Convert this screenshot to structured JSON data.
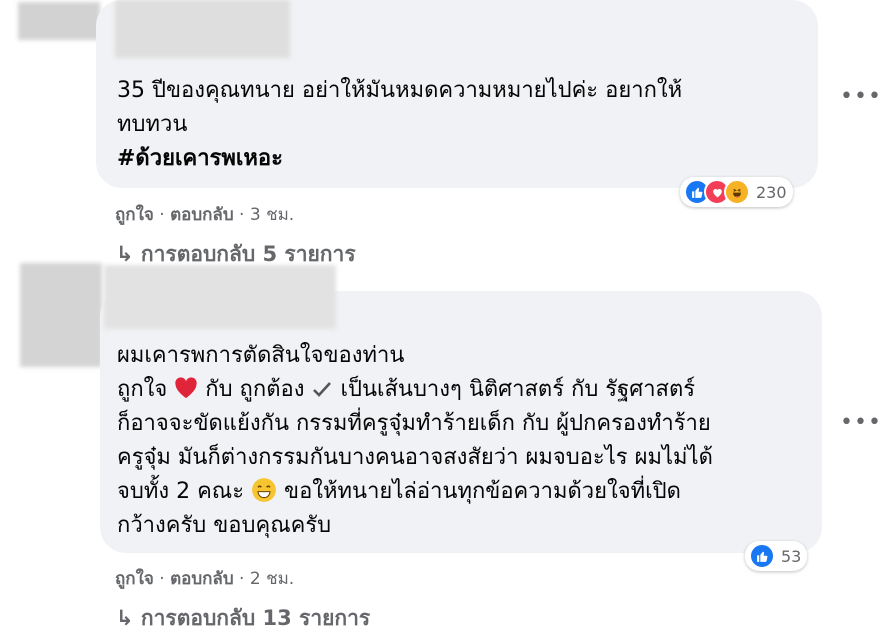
{
  "comments": [
    {
      "text_lines": [
        "35 ปีของคุณทนาย อย่าให้มันหมดความหมายไปค่ะ อยากให้",
        "ทบทวน"
      ],
      "hashtag": "#ด้วยเคารพเหอะ",
      "actions": {
        "like": "ถูกใจ",
        "reply": "ตอบกลับ",
        "time": "3 ชม."
      },
      "reaction_count": "230",
      "reactions": [
        "like-icon",
        "love-icon",
        "haha-icon"
      ],
      "replies_label": "การตอบกลับ 5 รายการ"
    },
    {
      "text_lines": [
        "ผมเคารพการตัดสินใจของท่าน",
        "ถูกใจ",
        "กับ ถูกต้อง",
        "เป็นเส้นบางๆ นิติศาสตร์ กับ รัฐศาสตร์",
        "ก็อาจจะขัดแย้งกัน กรรมที่ครูจุ๋มทำร้ายเด็ก กับ ผู้ปกครองทำร้าย",
        "ครูจุ๋ม มันก็ต่างกรรมกันบางคนอาจสงสัยว่า ผมจบอะไร ผมไม่ได้",
        "จบทั้ง 2 คณะ",
        "ขอให้ทนายไล่อ่านทุกข้อความด้วยใจที่เปิด",
        "กว้างครับ ขอบคุณครับ"
      ],
      "actions": {
        "like": "ถูกใจ",
        "reply": "ตอบกลับ",
        "time": "2 ชม."
      },
      "reaction_count": "53",
      "reactions": [
        "like-icon"
      ],
      "replies_label": "การตอบกลับ 13 รายการ"
    }
  ],
  "more_glyph": "•••",
  "separator": "·",
  "reply_arrow": "↳",
  "colors": {
    "like": "#1877f2",
    "love": "#f33e58",
    "haha": "#f7b125",
    "bubble": "#f0f2f5",
    "muted": "#65676b"
  }
}
